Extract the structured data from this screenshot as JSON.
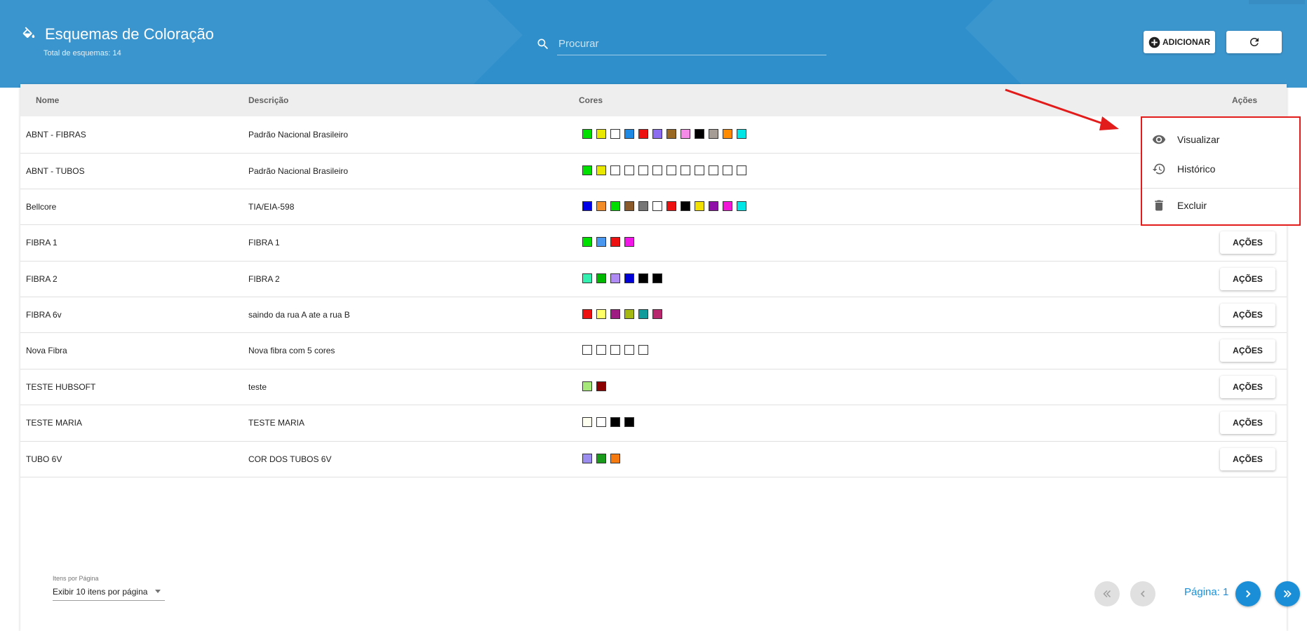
{
  "header": {
    "title": "Esquemas de Coloração",
    "subtitle": "Total de esquemas: 14",
    "search_placeholder": "Procurar",
    "add_label": "ADICIONAR"
  },
  "table": {
    "columns": {
      "nome": "Nome",
      "descricao": "Descrição",
      "cores": "Cores",
      "acoes": "Ações"
    },
    "action_label": "AÇÕES",
    "rows": [
      {
        "nome": "ABNT - FIBRAS",
        "descricao": "Padrão Nacional Brasileiro",
        "cores": [
          "#00e000",
          "#e8e800",
          "#ffffff",
          "#1e88e5",
          "#ee1111",
          "#8c6cf0",
          "#9a6a25",
          "#f48be6",
          "#000000",
          "#a59d95",
          "#ff8c00",
          "#00e5e5"
        ]
      },
      {
        "nome": "ABNT - TUBOS",
        "descricao": "Padrão Nacional Brasileiro",
        "cores": [
          "#00e000",
          "#e8e800",
          "#ffffff",
          "#ffffff",
          "#ffffff",
          "#ffffff",
          "#ffffff",
          "#ffffff",
          "#ffffff",
          "#ffffff",
          "#ffffff",
          "#ffffff"
        ]
      },
      {
        "nome": "Bellcore",
        "descricao": "TIA/EIA-598",
        "cores": [
          "#0000e8",
          "#f28c28",
          "#00dd00",
          "#8b5a2b",
          "#777777",
          "#ffffff",
          "#ee1111",
          "#000000",
          "#f2e000",
          "#8e10a8",
          "#f216d8",
          "#00e5e5"
        ]
      },
      {
        "nome": "FIBRA 1",
        "descricao": "FIBRA 1",
        "cores": [
          "#00e000",
          "#4a97f0",
          "#ee1111",
          "#f216e8"
        ]
      },
      {
        "nome": "FIBRA 2",
        "descricao": "FIBRA 2",
        "cores": [
          "#33f0b0",
          "#00b800",
          "#b08af5",
          "#0000d8",
          "#000000",
          "#000000"
        ]
      },
      {
        "nome": "FIBRA 6v",
        "descricao": "saindo da rua A ate a rua B",
        "cores": [
          "#ee1111",
          "#ffff66",
          "#9e1d83",
          "#a5b812",
          "#119b9b",
          "#b8286e"
        ]
      },
      {
        "nome": "Nova Fibra",
        "descricao": "Nova fibra com 5 cores",
        "cores": [
          "#ffffff",
          "#ffffff",
          "#ffffff",
          "#ffffff",
          "#ffffff"
        ]
      },
      {
        "nome": "TESTE HUBSOFT",
        "descricao": "teste",
        "cores": [
          "#a6e87a",
          "#8b0000"
        ]
      },
      {
        "nome": "TESTE MARIA",
        "descricao": "TESTE MARIA",
        "cores": [
          "#fffff0",
          "#ffffff",
          "#000000",
          "#000000"
        ]
      },
      {
        "nome": "TUBO 6V",
        "descricao": "COR DOS TUBOS 6V",
        "cores": [
          "#9b8df0",
          "#1a9a1a",
          "#f57a10"
        ]
      }
    ]
  },
  "footer": {
    "per_page_label": "Itens por Página",
    "per_page_value": "Exibir 10 itens por página",
    "page_label": "Página: 1"
  },
  "menu": {
    "items": [
      "Visualizar",
      "Histórico",
      "Excluir"
    ]
  },
  "colors": {
    "header_bg": "#2e8fcb",
    "accent": "#1a8fd8",
    "highlight": "#e21b1b"
  }
}
